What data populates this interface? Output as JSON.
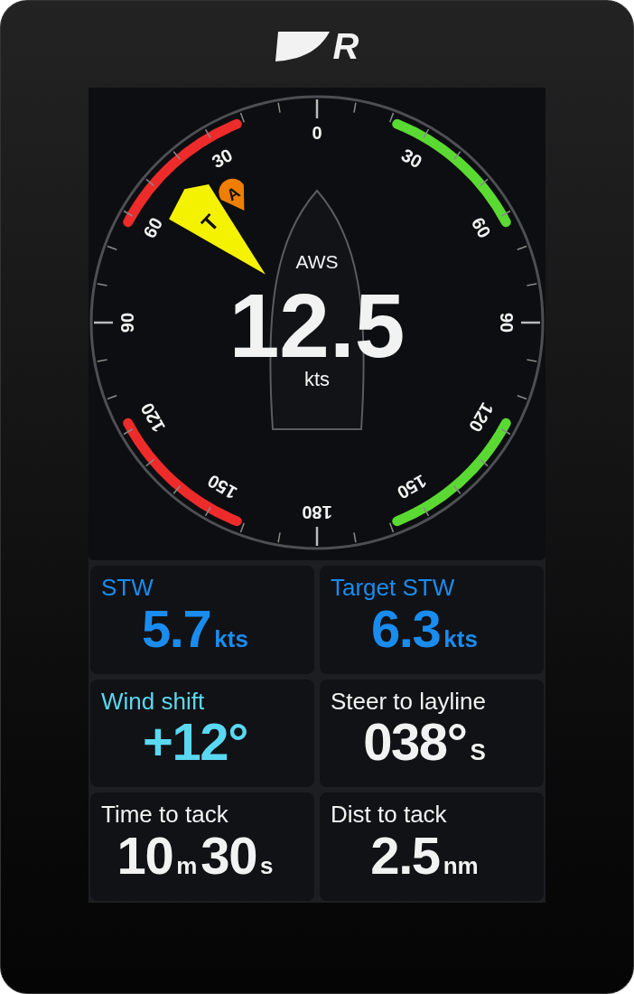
{
  "logo": {
    "letter": "R"
  },
  "dial": {
    "labels": [
      "0",
      "30",
      "60",
      "90",
      "120",
      "150",
      "180",
      "150",
      "120",
      "90",
      "60",
      "30"
    ],
    "zones": [
      {
        "kind": "port",
        "color": "#ee2b2b"
      },
      {
        "kind": "starboard",
        "color": "#5ad933"
      }
    ],
    "pointers": [
      {
        "kind": "true",
        "label": "T",
        "color": "#f5f200"
      },
      {
        "kind": "apparent",
        "label": "A",
        "color": "#f07e00"
      }
    ],
    "readout": {
      "label": "AWS",
      "value": "12.5",
      "unit": "kts"
    }
  },
  "tiles": [
    {
      "label": "STW",
      "color": "#1a8cf0",
      "parts": [
        {
          "kind": "number",
          "text": "5.7"
        },
        {
          "kind": "unit",
          "text": "kts"
        }
      ]
    },
    {
      "label": "Target STW",
      "color": "#1a8cf0",
      "parts": [
        {
          "kind": "number",
          "text": "6.3"
        },
        {
          "kind": "unit",
          "text": "kts"
        }
      ]
    },
    {
      "label": "Wind shift",
      "color": "#5ad8f2",
      "parts": [
        {
          "kind": "number",
          "text": "+12°"
        }
      ]
    },
    {
      "label": "Steer to layline",
      "color": "#f2f2f2",
      "parts": [
        {
          "kind": "number",
          "text": "038°"
        },
        {
          "kind": "unit",
          "text": "S"
        }
      ]
    },
    {
      "label": "Time to tack",
      "color": "#f2f2f2",
      "parts": [
        {
          "kind": "number",
          "text": "10"
        },
        {
          "kind": "unit",
          "text": "m"
        },
        {
          "kind": "number",
          "text": "30"
        },
        {
          "kind": "unit",
          "text": "s"
        }
      ]
    },
    {
      "label": "Dist to tack",
      "color": "#f2f2f2",
      "parts": [
        {
          "kind": "number",
          "text": "2.5"
        },
        {
          "kind": "unit",
          "text": "nm"
        }
      ]
    }
  ]
}
